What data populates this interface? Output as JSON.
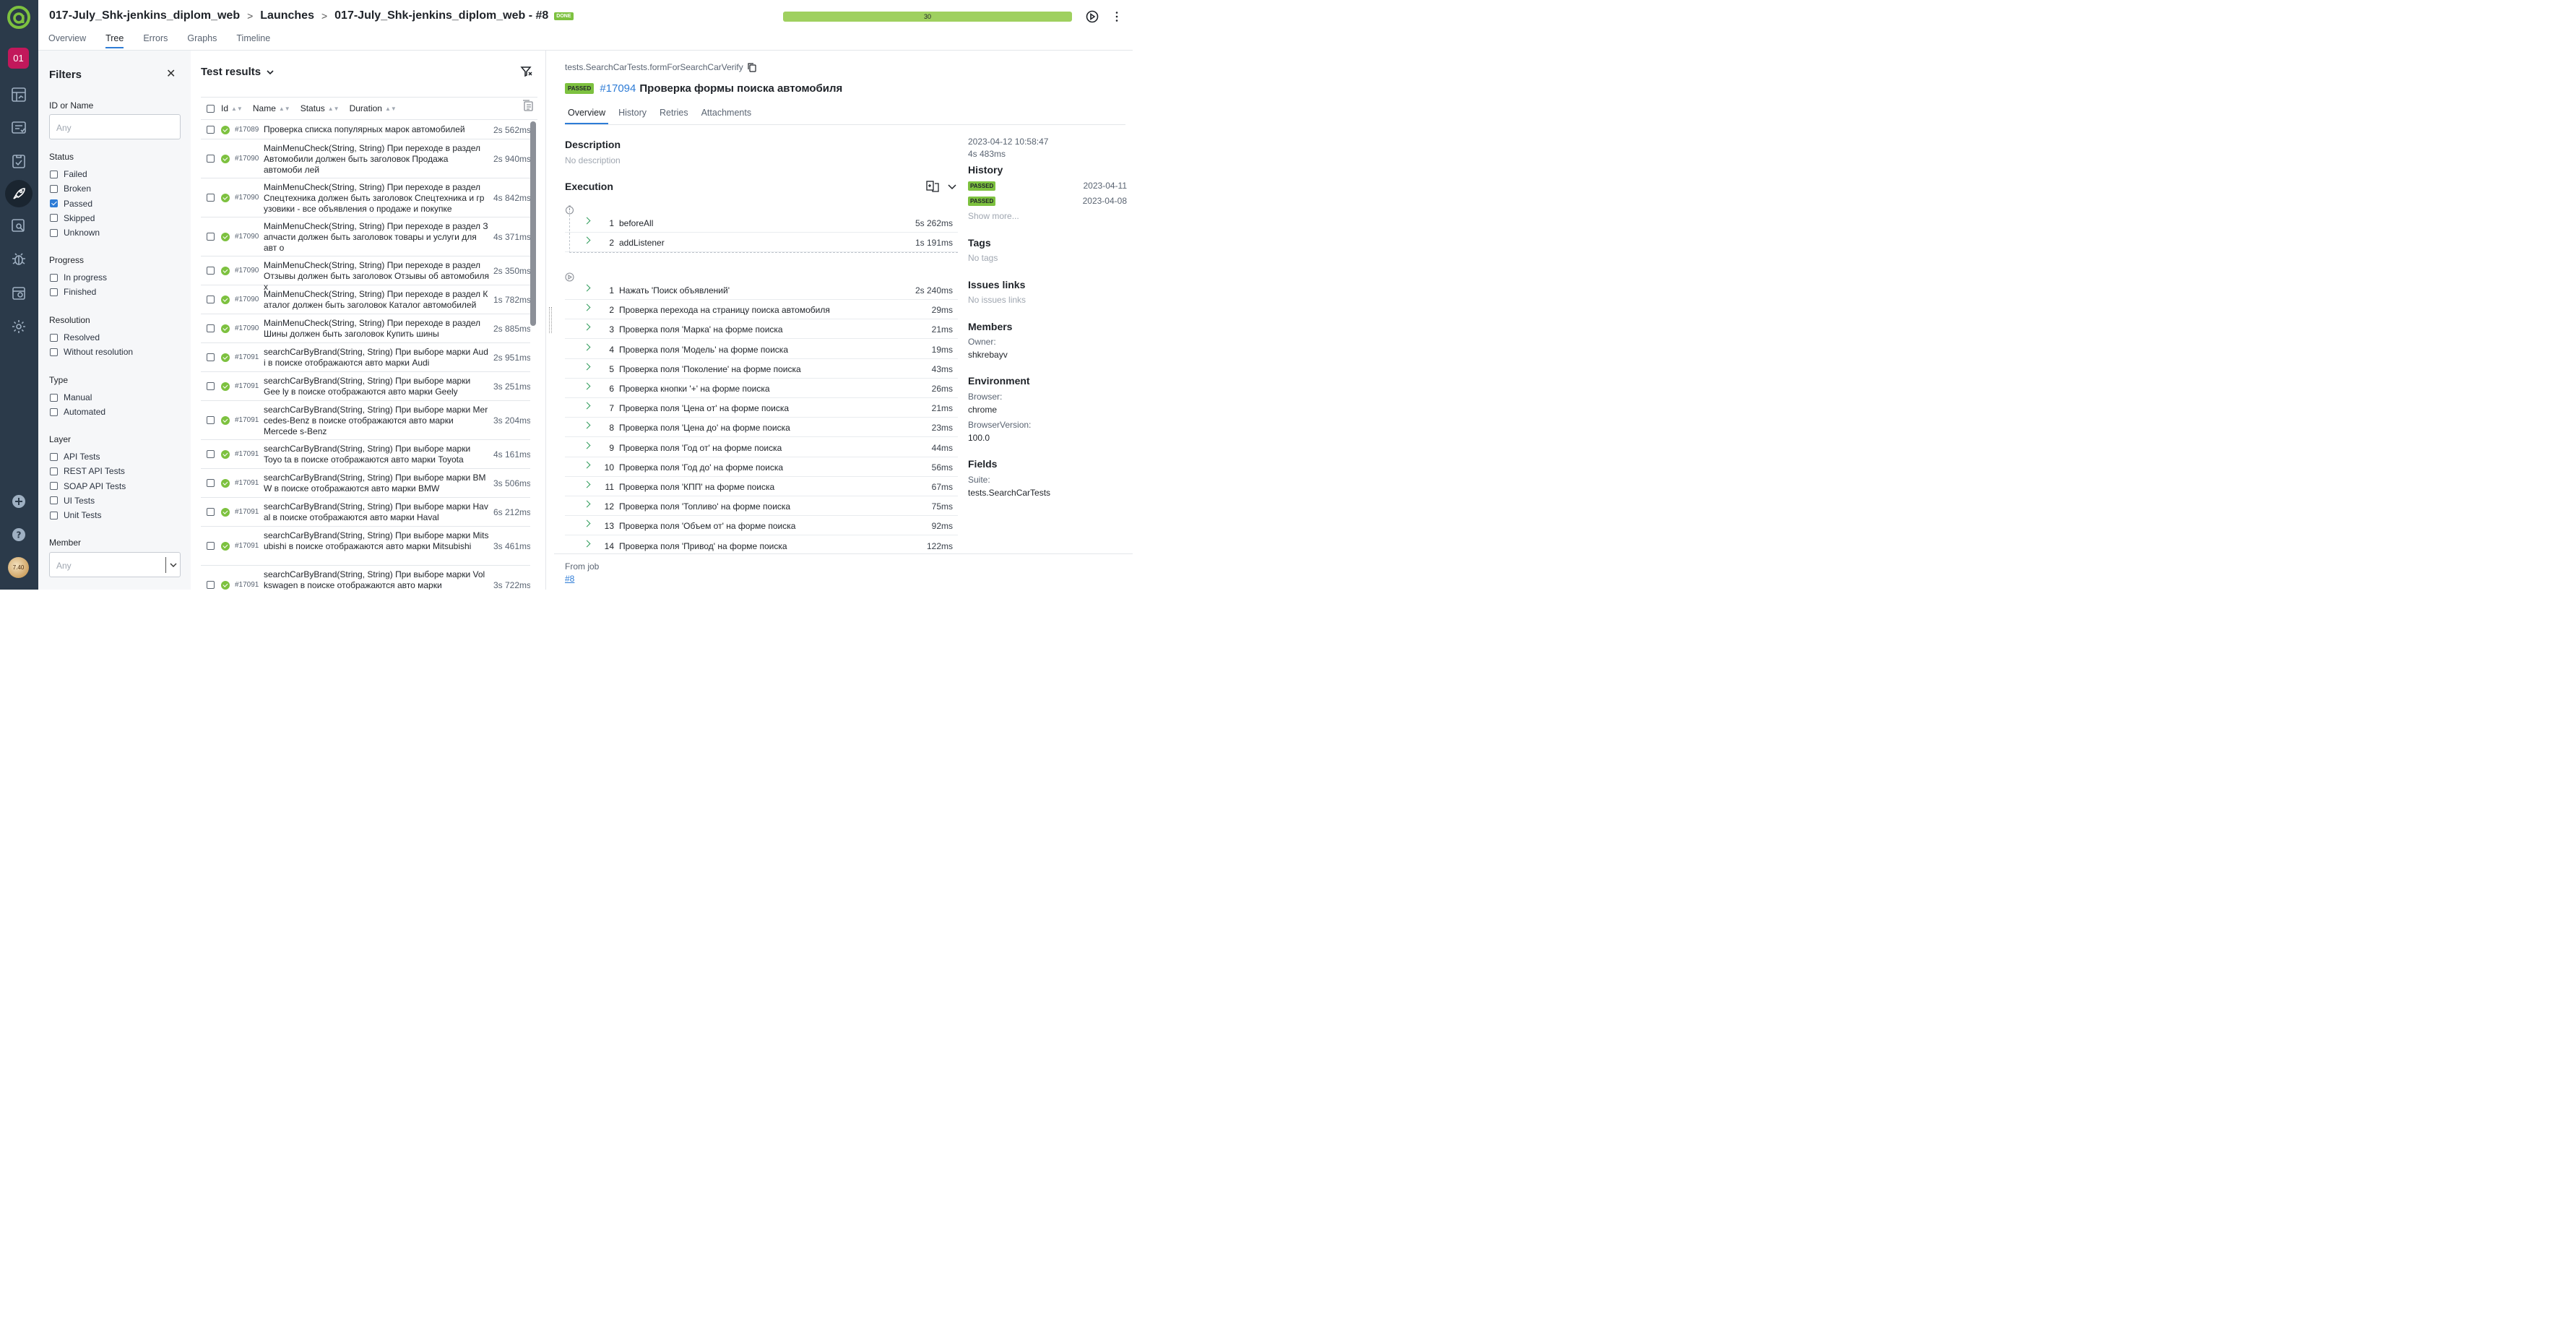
{
  "colors": {
    "rail": "#2b3a4a",
    "accent": "#2e7cd6",
    "passed": "#7dc13f",
    "project_badge": "#c2185b"
  },
  "rail": {
    "project_badge": "01",
    "avatar_text": "7.40"
  },
  "header": {
    "crumbs": [
      "017-July_Shk-jenkins_diplom_web",
      "Launches",
      "017-July_Shk-jenkins_diplom_web - #8"
    ],
    "badge": "DONE",
    "progress_value": "30",
    "tabs": [
      "Overview",
      "Tree",
      "Errors",
      "Graphs",
      "Timeline"
    ],
    "active_tab": "Tree"
  },
  "filters": {
    "title": "Filters",
    "id_label": "ID or Name",
    "id_placeholder": "Any",
    "groups": [
      {
        "label": "Status",
        "options": [
          {
            "label": "Failed",
            "checked": false
          },
          {
            "label": "Broken",
            "checked": false
          },
          {
            "label": "Passed",
            "checked": true
          },
          {
            "label": "Skipped",
            "checked": false
          },
          {
            "label": "Unknown",
            "checked": false
          }
        ]
      },
      {
        "label": "Progress",
        "options": [
          {
            "label": "In progress",
            "checked": false
          },
          {
            "label": "Finished",
            "checked": false
          }
        ]
      },
      {
        "label": "Resolution",
        "options": [
          {
            "label": "Resolved",
            "checked": false
          },
          {
            "label": "Without resolution",
            "checked": false
          }
        ]
      },
      {
        "label": "Type",
        "options": [
          {
            "label": "Manual",
            "checked": false
          },
          {
            "label": "Automated",
            "checked": false
          }
        ]
      },
      {
        "label": "Layer",
        "options": [
          {
            "label": "API Tests",
            "checked": false
          },
          {
            "label": "REST API Tests",
            "checked": false
          },
          {
            "label": "SOAP API Tests",
            "checked": false
          },
          {
            "label": "UI Tests",
            "checked": false
          },
          {
            "label": "Unit Tests",
            "checked": false
          }
        ]
      }
    ],
    "member_label": "Member",
    "member_placeholder": "Any"
  },
  "results": {
    "title": "Test results",
    "columns": [
      "Id",
      "Name",
      "Status",
      "Duration"
    ],
    "rows": [
      {
        "id": "#17089",
        "name": "Проверка списка популярных марок автомобилей",
        "duration": "2s 562ms"
      },
      {
        "id": "#17090",
        "name": "MainMenuCheck(String, String) При переходе в раздел Автомобили должен быть заголовок Продажа автомоби лей",
        "duration": "2s 940ms"
      },
      {
        "id": "#17090",
        "name": "MainMenuCheck(String, String) При переходе в раздел Спецтехника должен быть заголовок Спецтехника и гр узовики - все объявления о продаже и покупке",
        "duration": "4s 842ms"
      },
      {
        "id": "#17090",
        "name": "MainMenuCheck(String, String) При переходе в раздел З апчасти должен быть заголовок товары и услуги для авт о",
        "duration": "4s 371ms"
      },
      {
        "id": "#17090",
        "name": "MainMenuCheck(String, String) При переходе в раздел Отзывы должен быть заголовок Отзывы об автомобиля х",
        "duration": "2s 350ms"
      },
      {
        "id": "#17090",
        "name": "MainMenuCheck(String, String) При переходе в раздел К аталог должен быть заголовок Каталог автомобилей",
        "duration": "1s 782ms"
      },
      {
        "id": "#17090",
        "name": "MainMenuCheck(String, String) При переходе в раздел Шины должен быть заголовок Купить шины",
        "duration": "2s 885ms"
      },
      {
        "id": "#17091",
        "name": "searchCarByBrand(String, String) При выборе марки Aud i в поиске отображаются авто марки Audi",
        "duration": "2s 951ms"
      },
      {
        "id": "#17091",
        "name": "searchCarByBrand(String, String) При выборе марки Gee ly в поиске отображаются авто марки Geely",
        "duration": "3s 251ms"
      },
      {
        "id": "#17091",
        "name": "searchCarByBrand(String, String) При выборе марки Mer cedes-Benz в поиске отображаются авто марки Mercede s-Benz",
        "duration": "3s 204ms"
      },
      {
        "id": "#17091",
        "name": "searchCarByBrand(String, String) При выборе марки Toyo ta в поиске отображаются авто марки Toyota",
        "duration": "4s 161ms"
      },
      {
        "id": "#17091",
        "name": "searchCarByBrand(String, String) При выборе марки BM W в поиске отображаются авто марки BMW",
        "duration": "3s 506ms"
      },
      {
        "id": "#17091",
        "name": "searchCarByBrand(String, String) При выборе марки Hav al в поиске отображаются авто марки Haval",
        "duration": "6s 212ms"
      },
      {
        "id": "#17091",
        "name": "searchCarByBrand(String, String) При выборе марки Mits ubishi в поиске отображаются авто марки Mitsubishi",
        "duration": "3s 461ms"
      },
      {
        "id": "#17091",
        "name": "searchCarByBrand(String, String) При выборе марки Vol kswagen в поиске отображаются авто марки Volkswagen",
        "duration": "3s 722ms"
      }
    ]
  },
  "detail": {
    "full_name": "tests.SearchCarTests.formForSearchCarVerify",
    "status": "PASSED",
    "number": "#17094",
    "title": "Проверка формы поиска автомобиля",
    "tabs": [
      "Overview",
      "History",
      "Retries",
      "Attachments"
    ],
    "description_label": "Description",
    "description_text": "No description",
    "execution_label": "Execution",
    "setup_steps": [
      {
        "n": "1",
        "name": "beforeAll",
        "dur": "5s 262ms"
      },
      {
        "n": "2",
        "name": "addListener",
        "dur": "1s 191ms"
      }
    ],
    "steps": [
      {
        "n": "1",
        "name": "Нажать 'Поиск объявлений'",
        "dur": "2s 240ms"
      },
      {
        "n": "2",
        "name": "Проверка перехода на страницу поиска автомобиля",
        "dur": "29ms"
      },
      {
        "n": "3",
        "name": "Проверка поля 'Марка' на форме поиска",
        "dur": "21ms"
      },
      {
        "n": "4",
        "name": "Проверка поля 'Модель' на форме поиска",
        "dur": "19ms"
      },
      {
        "n": "5",
        "name": "Проверка поля 'Поколение' на форме поиска",
        "dur": "43ms"
      },
      {
        "n": "6",
        "name": "Проверка кнопки '+' на форме поиска",
        "dur": "26ms"
      },
      {
        "n": "7",
        "name": "Проверка поля 'Цена от' на форме поиска",
        "dur": "21ms"
      },
      {
        "n": "8",
        "name": "Проверка поля 'Цена до' на форме поиска",
        "dur": "23ms"
      },
      {
        "n": "9",
        "name": "Проверка поля 'Год от' на форме поиска",
        "dur": "44ms"
      },
      {
        "n": "10",
        "name": "Проверка поля 'Год до' на форме поиска",
        "dur": "56ms"
      },
      {
        "n": "11",
        "name": "Проверка поля 'КПП' на форме поиска",
        "dur": "67ms"
      },
      {
        "n": "12",
        "name": "Проверка поля 'Топливо' на форме поиска",
        "dur": "75ms"
      },
      {
        "n": "13",
        "name": "Проверка поля 'Объем от' на форме поиска",
        "dur": "92ms"
      },
      {
        "n": "14",
        "name": "Проверка поля 'Привод' на форме поиска",
        "dur": "122ms"
      }
    ],
    "footer_label": "From job",
    "footer_link": "#8",
    "side": {
      "datetime": "2023-04-12 10:58:47",
      "duration": "4s 483ms",
      "history_label": "History",
      "history": [
        {
          "status": "PASSED",
          "date": "2023-04-11"
        },
        {
          "status": "PASSED",
          "date": "2023-04-08"
        }
      ],
      "show_more": "Show more...",
      "tags_label": "Tags",
      "tags_text": "No tags",
      "issues_label": "Issues links",
      "issues_text": "No issues links",
      "members_label": "Members",
      "owner_label": "Owner:",
      "owner_value": "shkrebayv",
      "env_label": "Environment",
      "browser_label": "Browser:",
      "browser_value": "chrome",
      "browser_version_label": "BrowserVersion:",
      "browser_version_value": "100.0",
      "fields_label": "Fields",
      "suite_label": "Suite:",
      "suite_value": "tests.SearchCarTests"
    }
  }
}
